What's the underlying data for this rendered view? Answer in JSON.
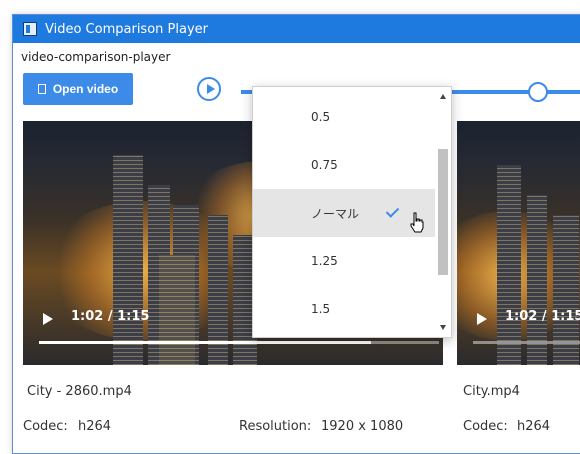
{
  "window": {
    "title": "Video Comparison Player",
    "subtitle": "video-comparison-player"
  },
  "toolbar": {
    "open_video_label": "Open video",
    "speed_menu": {
      "options": [
        "0.5",
        "0.75",
        "ノーマル",
        "1.25",
        "1.5"
      ],
      "selected": "ノーマル"
    }
  },
  "video_left": {
    "time": "1:02 / 1:15",
    "progress": 0.83,
    "filename": "City - 2860.mp4",
    "codec_label": "Codec:",
    "codec_value": "h264",
    "resolution_label": "Resolution:",
    "resolution_value": "1920 x 1080"
  },
  "video_right": {
    "time": "1:02 / 1:15",
    "filename": "City.mp4",
    "codec_label": "Codec:",
    "codec_value": "h264"
  },
  "colors": {
    "titlebar": "#1f7ae0",
    "accent": "#3d8be8"
  }
}
